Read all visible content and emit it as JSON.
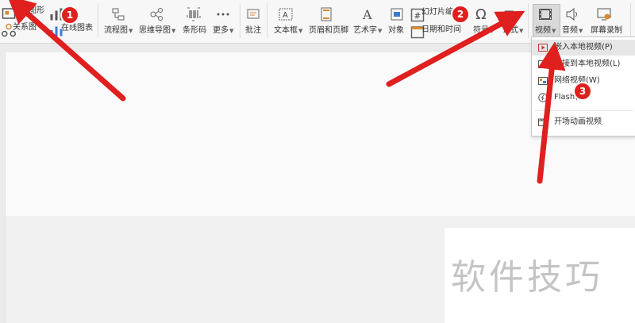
{
  "ribbon": {
    "smart_graphic": "智能图形",
    "relation_graph": "关系图",
    "online_chart": "在线图表",
    "flowchart": "流程图",
    "mindmap": "思维导图",
    "barcode": "条形码",
    "more": "更多",
    "comment": "批注",
    "textbox": "文本框",
    "header_footer": "页眉和页脚",
    "art_text": "艺术字",
    "object": "对象",
    "slide_number": "幻灯片编号",
    "date_time": "日期和时间",
    "symbol": "符号",
    "formula": "公式",
    "video": "视频",
    "audio": "音频",
    "screen_record": "屏幕录制"
  },
  "video_menu": {
    "items": [
      {
        "label": "嵌入本地视频(P)",
        "icon": "embed-video-icon"
      },
      {
        "label": "链接到本地视频(L)",
        "icon": "link-video-icon"
      },
      {
        "label": "网络视频(W)",
        "icon": "web-video-icon"
      },
      {
        "label": "Flash(F)",
        "icon": "flash-icon"
      },
      {
        "label": "开场动画视频",
        "icon": "intro-video-icon"
      }
    ]
  },
  "annotations": {
    "badge1": "1",
    "badge2": "2",
    "badge3": "3",
    "arrow_color": "#e01f1f"
  },
  "watermark": "软件技巧"
}
